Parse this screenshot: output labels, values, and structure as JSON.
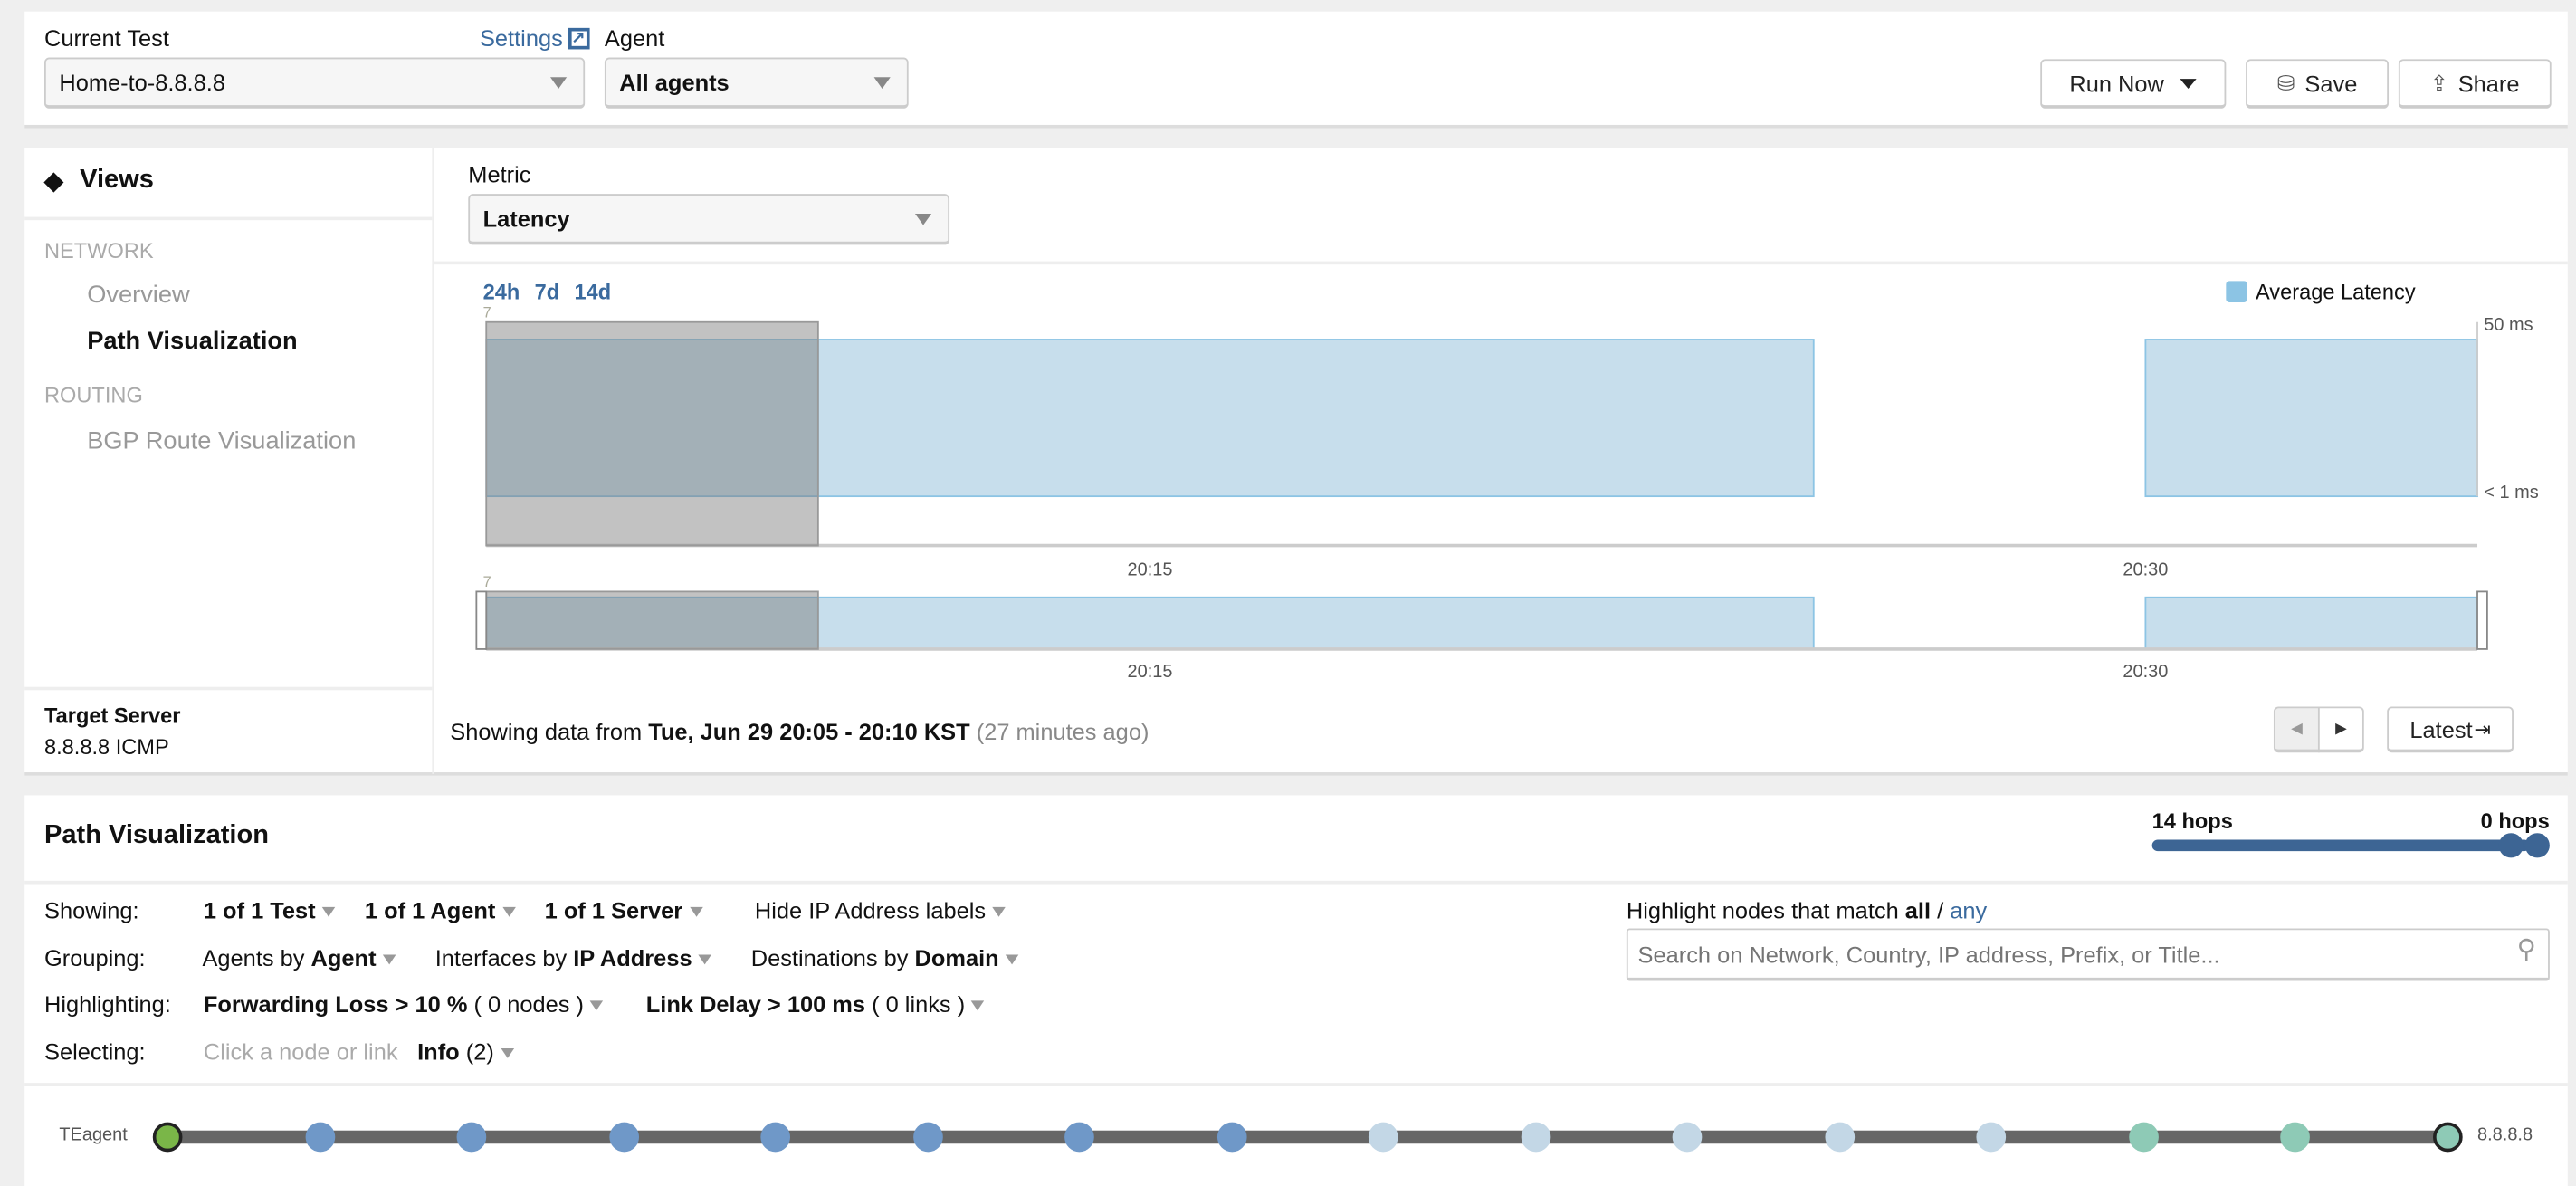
{
  "header": {
    "current_test_label": "Current Test",
    "settings_link": "Settings",
    "current_test_value": "Home-to-8.8.8.8",
    "agent_label": "Agent",
    "agent_value": "All agents",
    "run_now": "Run Now",
    "save": "Save",
    "share": "Share"
  },
  "views": {
    "title": "Views",
    "sections": [
      {
        "label": "NETWORK",
        "items": [
          {
            "label": "Overview",
            "active": false
          },
          {
            "label": "Path Visualization",
            "active": true
          }
        ]
      },
      {
        "label": "ROUTING",
        "items": [
          {
            "label": "BGP Route Visualization",
            "active": false
          }
        ]
      }
    ],
    "target_label": "Target Server",
    "target_value": "8.8.8.8 ICMP"
  },
  "metric": {
    "label": "Metric",
    "value": "Latency"
  },
  "ranges": [
    "24h",
    "7d",
    "14d"
  ],
  "footer": {
    "prefix": "Showing data from ",
    "range": "Tue, Jun 29 20:05 - 20:10 KST",
    "ago": "(27 minutes ago)",
    "latest": "Latest"
  },
  "chart_data": {
    "type": "area",
    "legend": "Average Latency",
    "legend_position": "top-right",
    "series_color": "#8cc4e4",
    "x_ticks": [
      "20:15",
      "20:30"
    ],
    "y_ticks": [
      "50 ms",
      "< 1 ms"
    ],
    "xlim": [
      "20:05",
      "20:35"
    ],
    "points": [
      {
        "start": "20:05",
        "end": "20:10",
        "value": 45
      },
      {
        "start": "20:10",
        "end": "20:25",
        "value": 45
      },
      {
        "start": "20:25",
        "end": "20:30",
        "value": null
      },
      {
        "start": "20:30",
        "end": "20:35",
        "value": 45
      }
    ],
    "selected": {
      "start": "20:05",
      "end": "20:10"
    },
    "marker": "7"
  },
  "path": {
    "title": "Path Visualization",
    "hops_left": "14 hops",
    "hops_right": "0 hops",
    "showing_label": "Showing:",
    "showing": [
      "1 of 1 Test",
      "1 of 1 Agent",
      "1 of 1 Server",
      "Hide IP Address labels"
    ],
    "grouping_label": "Grouping:",
    "grouping": [
      {
        "pre": "Agents by ",
        "b": "Agent"
      },
      {
        "pre": "Interfaces by ",
        "b": "IP Address"
      },
      {
        "pre": "Destinations by ",
        "b": "Domain"
      }
    ],
    "highlighting_label": "Highlighting:",
    "highlighting": [
      {
        "b": "Forwarding Loss > 10 %",
        "post": " ( 0 nodes )"
      },
      {
        "b": "Link Delay > 100 ms",
        "post": " ( 0 links )"
      }
    ],
    "selecting_label": "Selecting:",
    "selecting_hint": "Click a node or link",
    "info_b": "Info",
    "info_post": " (2)",
    "match_prefix": "Highlight nodes that match ",
    "match_all": "all",
    "match_sep": " / ",
    "match_any": "any",
    "search_placeholder": "Search on Network, Country, IP address, Prefix, or Title...",
    "source": "TEagent",
    "destination": "8.8.8.8",
    "nodes": [
      "#7ab648",
      "#6f98c8",
      "#6f98c8",
      "#6f98c8",
      "#6f98c8",
      "#6f98c8",
      "#6f98c8",
      "#6f98c8",
      "#c3d7e6",
      "#c3d7e6",
      "#c3d7e6",
      "#c3d7e6",
      "#c3d7e6",
      "#8ecab6",
      "#8ecab6",
      "#8ecab6"
    ]
  }
}
